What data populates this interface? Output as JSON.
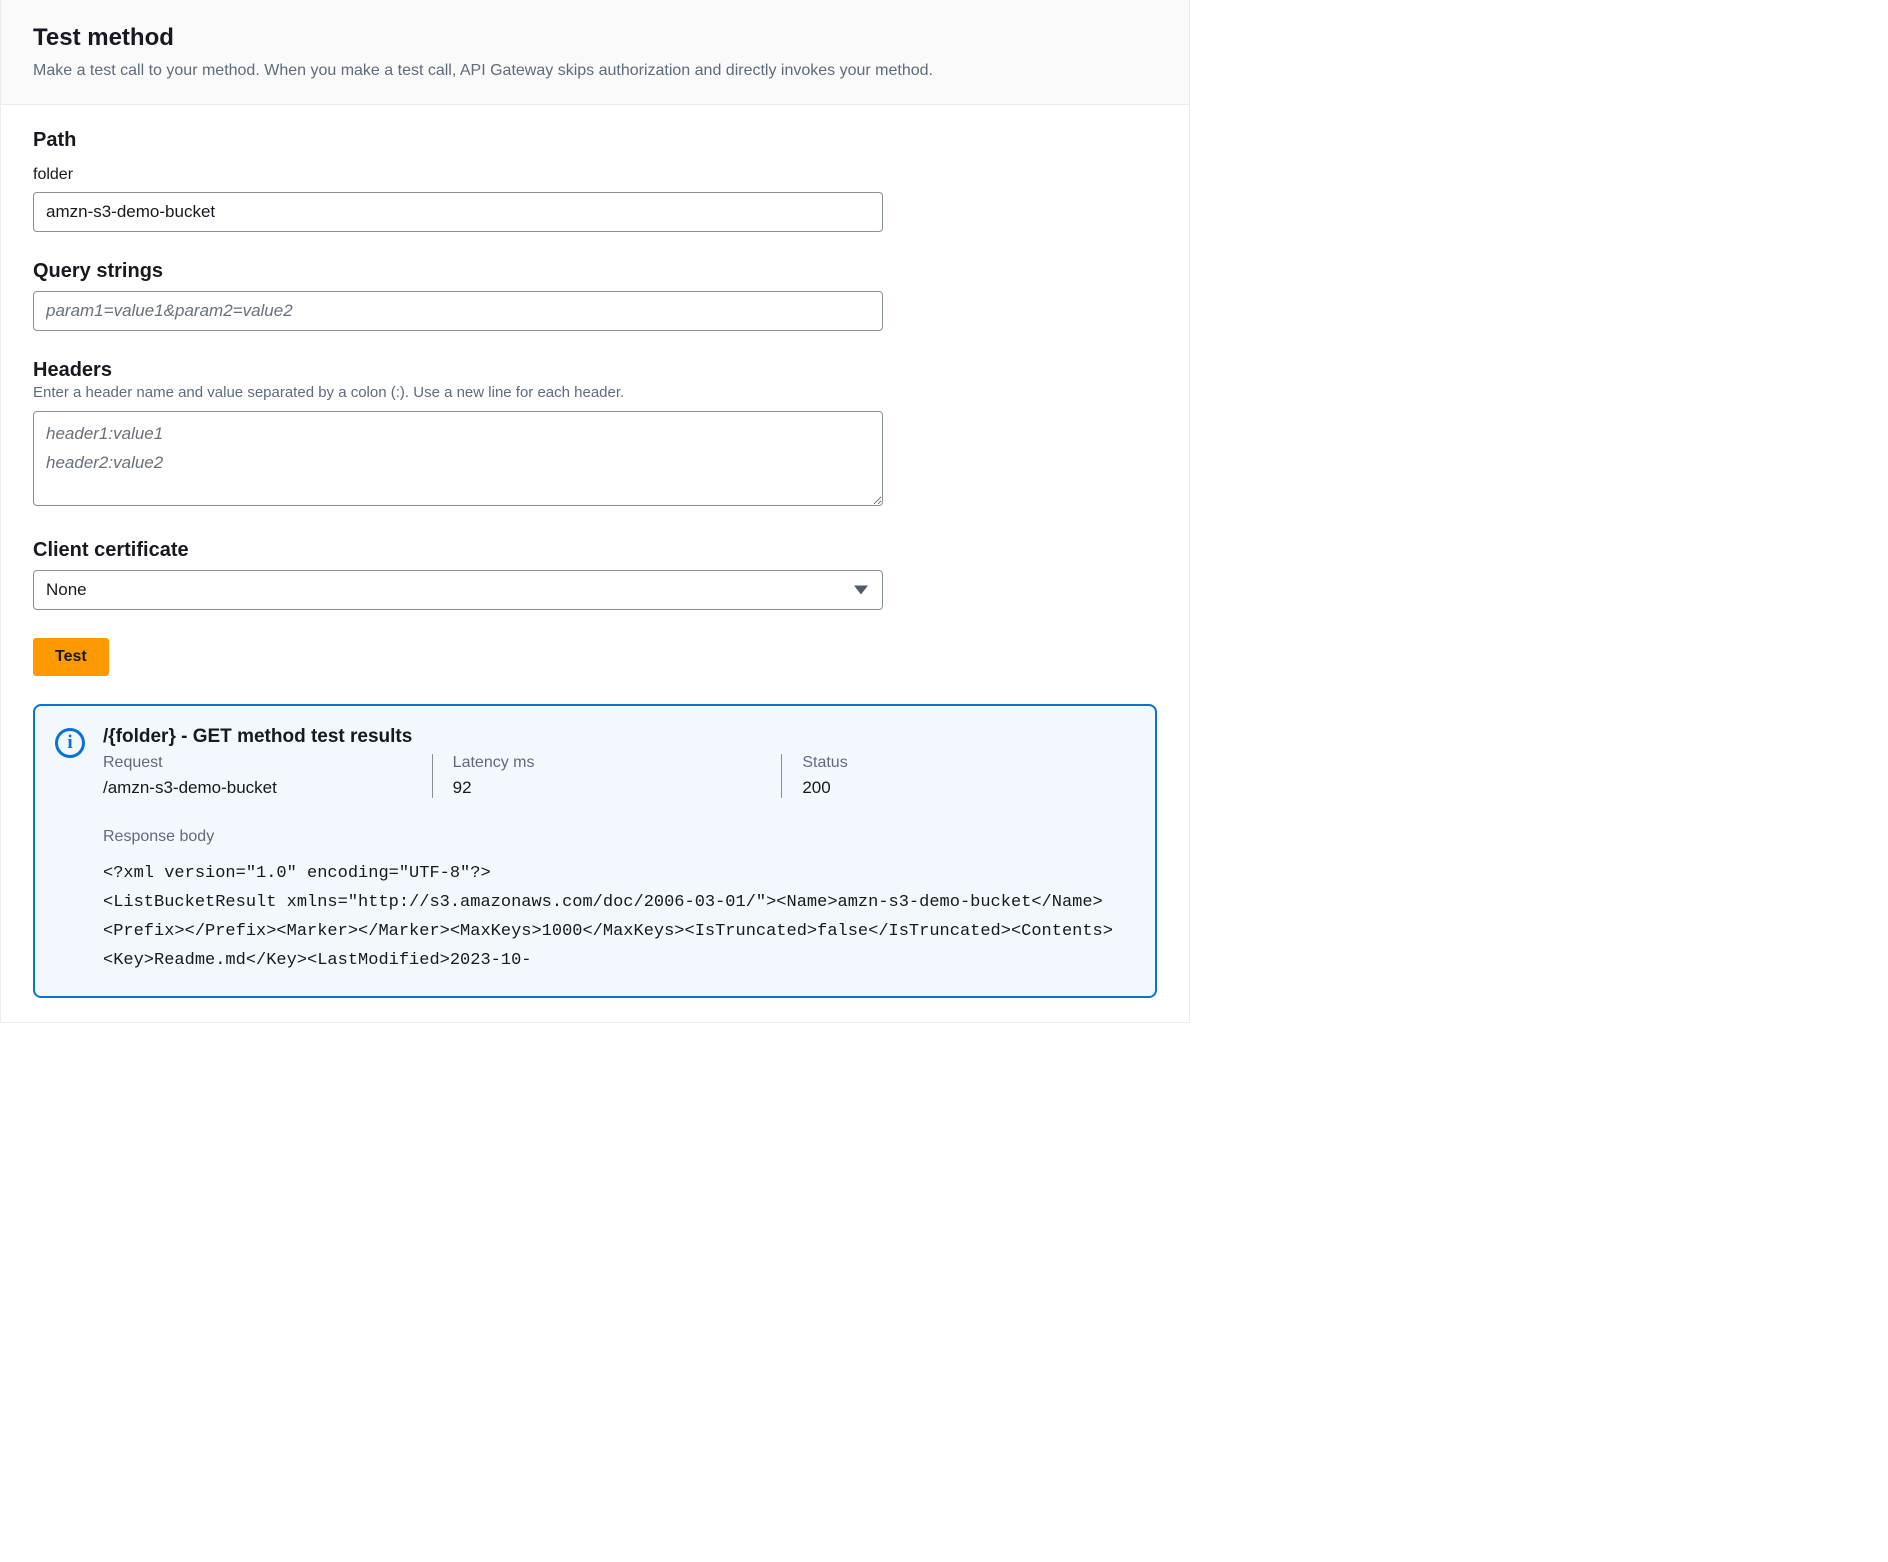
{
  "header": {
    "title": "Test method",
    "description": "Make a test call to your method. When you make a test call, API Gateway skips authorization and directly invokes your method."
  },
  "path": {
    "heading": "Path",
    "folder_label": "folder",
    "folder_value": "amzn-s3-demo-bucket"
  },
  "query": {
    "heading": "Query strings",
    "placeholder": "param1=value1&param2=value2",
    "value": ""
  },
  "headers": {
    "heading": "Headers",
    "help": "Enter a header name and value separated by a colon (:). Use a new line for each header.",
    "placeholder": "header1:value1\nheader2:value2",
    "value": ""
  },
  "client_cert": {
    "heading": "Client certificate",
    "selected": "None"
  },
  "actions": {
    "test_label": "Test"
  },
  "result": {
    "title": "/{folder} - GET method test results",
    "request_label": "Request",
    "request_value": "/amzn-s3-demo-bucket",
    "latency_label": "Latency ms",
    "latency_value": "92",
    "status_label": "Status",
    "status_value": "200",
    "response_body_label": "Response body",
    "response_body": "<?xml version=\"1.0\" encoding=\"UTF-8\"?>\n<ListBucketResult xmlns=\"http://s3.amazonaws.com/doc/2006-03-01/\"><Name>amzn-s3-demo-bucket</Name><Prefix></Prefix><Marker></Marker><MaxKeys>1000</MaxKeys><IsTruncated>false</IsTruncated><Contents><Key>Readme.md</Key><LastModified>2023-10-"
  }
}
